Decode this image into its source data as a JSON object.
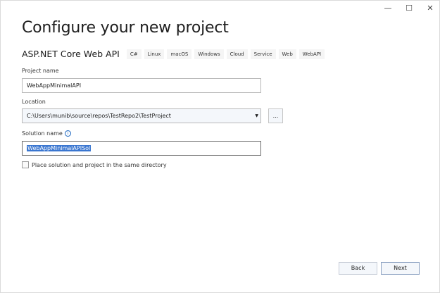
{
  "window": {
    "minimize": "—",
    "maximize": "☐",
    "close": "✕"
  },
  "title": "Configure your new project",
  "template": {
    "name": "ASP.NET Core Web API",
    "tags": [
      "C#",
      "Linux",
      "macOS",
      "Windows",
      "Cloud",
      "Service",
      "Web",
      "WebAPI"
    ]
  },
  "project_name": {
    "label": "Project name",
    "value": "WebAppMinimalAPI"
  },
  "location": {
    "label": "Location",
    "value": "C:\\Users\\munib\\source\\repos\\TestRepo2\\TestProject",
    "browse": "..."
  },
  "solution_name": {
    "label": "Solution name",
    "value": "WebAppMinimalAPISol",
    "info": "i"
  },
  "same_dir": {
    "label": "Place solution and project in the same directory",
    "checked": false
  },
  "buttons": {
    "back": "Back",
    "next": "Next"
  }
}
